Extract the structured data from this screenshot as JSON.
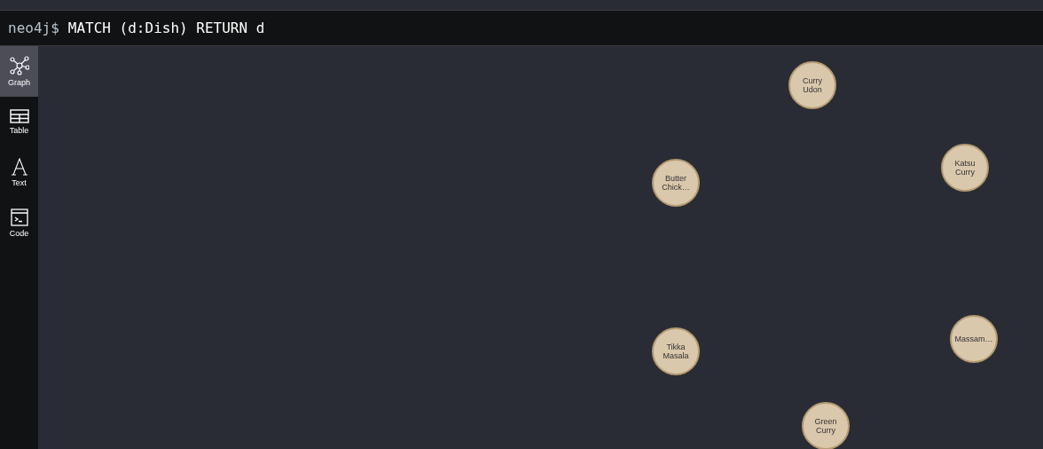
{
  "command_bar": {
    "prompt": "neo4j$",
    "query": "MATCH (d:Dish) RETURN d"
  },
  "sidebar": {
    "items": [
      {
        "kind": "graph",
        "label": "Graph",
        "selected": true
      },
      {
        "kind": "table",
        "label": "Table",
        "selected": false
      },
      {
        "kind": "text",
        "label": "Text",
        "selected": false
      },
      {
        "kind": "code",
        "label": "Code",
        "selected": false
      }
    ]
  },
  "graph": {
    "nodes": [
      {
        "label": "Curry Udon"
      },
      {
        "label": "Butter Chick…"
      },
      {
        "label": "Katsu Curry"
      },
      {
        "label": "Tikka Masala"
      },
      {
        "label": "Massam…"
      },
      {
        "label": "Green Curry"
      }
    ]
  }
}
